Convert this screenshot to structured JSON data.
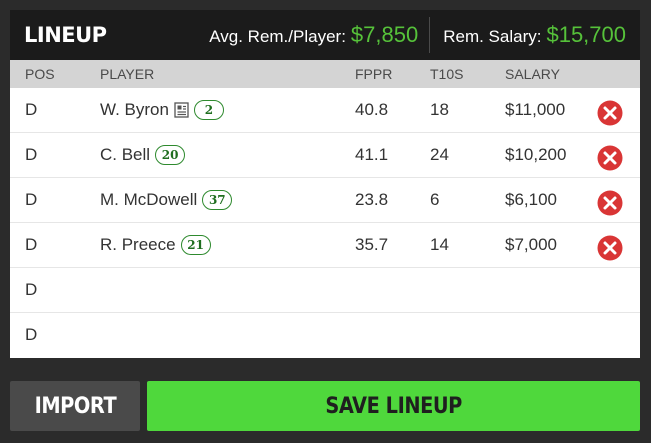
{
  "header": {
    "title": "LINEUP",
    "avg_label": "Avg. Rem./Player:",
    "avg_value": "$7,850",
    "rem_label": "Rem. Salary:",
    "rem_value": "$15,700"
  },
  "columns": {
    "pos": "POS",
    "player": "PLAYER",
    "fppr": "FPPR",
    "t10s": "T10S",
    "salary": "SALARY"
  },
  "rows": [
    {
      "pos": "D",
      "player": "W. Byron",
      "has_news": true,
      "number": "2",
      "fppr": "40.8",
      "t10s": "18",
      "salary": "$11,000"
    },
    {
      "pos": "D",
      "player": "C. Bell",
      "has_news": false,
      "number": "20",
      "fppr": "41.1",
      "t10s": "24",
      "salary": "$10,200"
    },
    {
      "pos": "D",
      "player": "M. McDowell",
      "has_news": false,
      "number": "37",
      "fppr": "23.8",
      "t10s": "6",
      "salary": "$6,100"
    },
    {
      "pos": "D",
      "player": "R. Preece",
      "has_news": false,
      "number": "21",
      "fppr": "35.7",
      "t10s": "14",
      "salary": "$7,000"
    },
    {
      "pos": "D"
    },
    {
      "pos": "D"
    }
  ],
  "buttons": {
    "import": "IMPORT",
    "save": "SAVE LINEUP"
  },
  "colors": {
    "accent_green": "#56c23a",
    "save_button": "#4fd83c",
    "remove_red": "#d93535",
    "header_bg": "#1b1b1b"
  },
  "icons": {
    "news": "news-icon",
    "remove": "remove-icon"
  }
}
